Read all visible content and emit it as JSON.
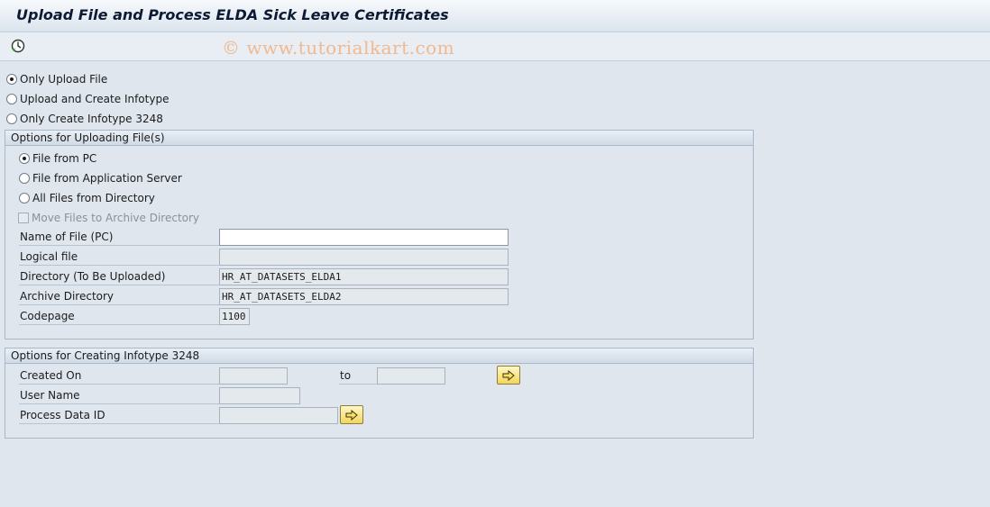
{
  "window": {
    "title": "Upload File and Process ELDA Sick Leave Certificates"
  },
  "toolbar": {
    "execute_icon": "execute-icon",
    "watermark": "© www.tutorialkart.com"
  },
  "mode_options": [
    {
      "label": "Only Upload File",
      "selected": true
    },
    {
      "label": "Upload and Create Infotype",
      "selected": false
    },
    {
      "label": "Only Create Infotype 3248",
      "selected": false
    }
  ],
  "upload_group": {
    "title": "Options for Uploading File(s)",
    "source_options": [
      {
        "label": "File from PC",
        "selected": true
      },
      {
        "label": "File from Application Server",
        "selected": false
      },
      {
        "label": "All Files from Directory",
        "selected": false
      }
    ],
    "move_files": {
      "label": "Move Files to Archive Directory",
      "checked": false,
      "enabled": false
    },
    "fields": {
      "name_of_file": {
        "label": "Name of File (PC)",
        "value": ""
      },
      "logical_file": {
        "label": "Logical file",
        "value": ""
      },
      "directory": {
        "label": "Directory (To Be Uploaded)",
        "value": "HR_AT_DATASETS_ELDA1"
      },
      "archive_directory": {
        "label": "Archive Directory",
        "value": "HR_AT_DATASETS_ELDA2"
      },
      "codepage": {
        "label": "Codepage",
        "value": "1100"
      }
    }
  },
  "infotype_group": {
    "title": "Options for Creating Infotype 3248",
    "created_on": {
      "label": "Created On",
      "from": "",
      "to_label": "to",
      "to": ""
    },
    "user_name": {
      "label": "User Name",
      "value": ""
    },
    "process_data_id": {
      "label": "Process Data ID",
      "value": ""
    }
  },
  "colors": {
    "background": "#dfe6ee",
    "group_border": "#a9b7c6",
    "button_yellow": "#f3d65a",
    "watermark": "#f0b98f"
  }
}
